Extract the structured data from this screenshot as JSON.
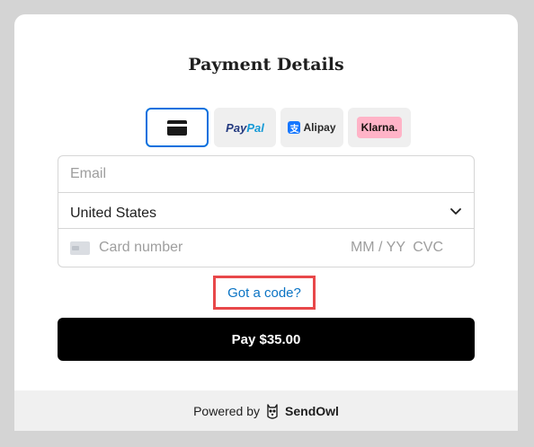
{
  "header": {
    "title": "Payment Details"
  },
  "payment_methods": [
    {
      "id": "card",
      "icon": "card-icon",
      "selected": true
    },
    {
      "id": "paypal",
      "label_part1": "Pay",
      "label_part2": "Pal",
      "colors": [
        "#253b80",
        "#179bd7"
      ]
    },
    {
      "id": "alipay",
      "mark": "支",
      "label": "Alipay",
      "color": "#1677ff"
    },
    {
      "id": "klarna",
      "label": "Klarna.",
      "color": "#ffb3c7"
    }
  ],
  "form": {
    "email_placeholder": "Email",
    "country_value": "United States",
    "card_number_placeholder": "Card number",
    "expiry_placeholder": "MM / YY",
    "cvc_placeholder": "CVC"
  },
  "coupon": {
    "link_text": "Got a code?"
  },
  "pay_button": {
    "label": "Pay $35.00"
  },
  "footer": {
    "powered_by": "Powered by",
    "brand": "SendOwl"
  },
  "colors": {
    "accent": "#0570de",
    "link": "#0b74c4",
    "highlight": "#e8484a",
    "button_bg": "#000000"
  }
}
